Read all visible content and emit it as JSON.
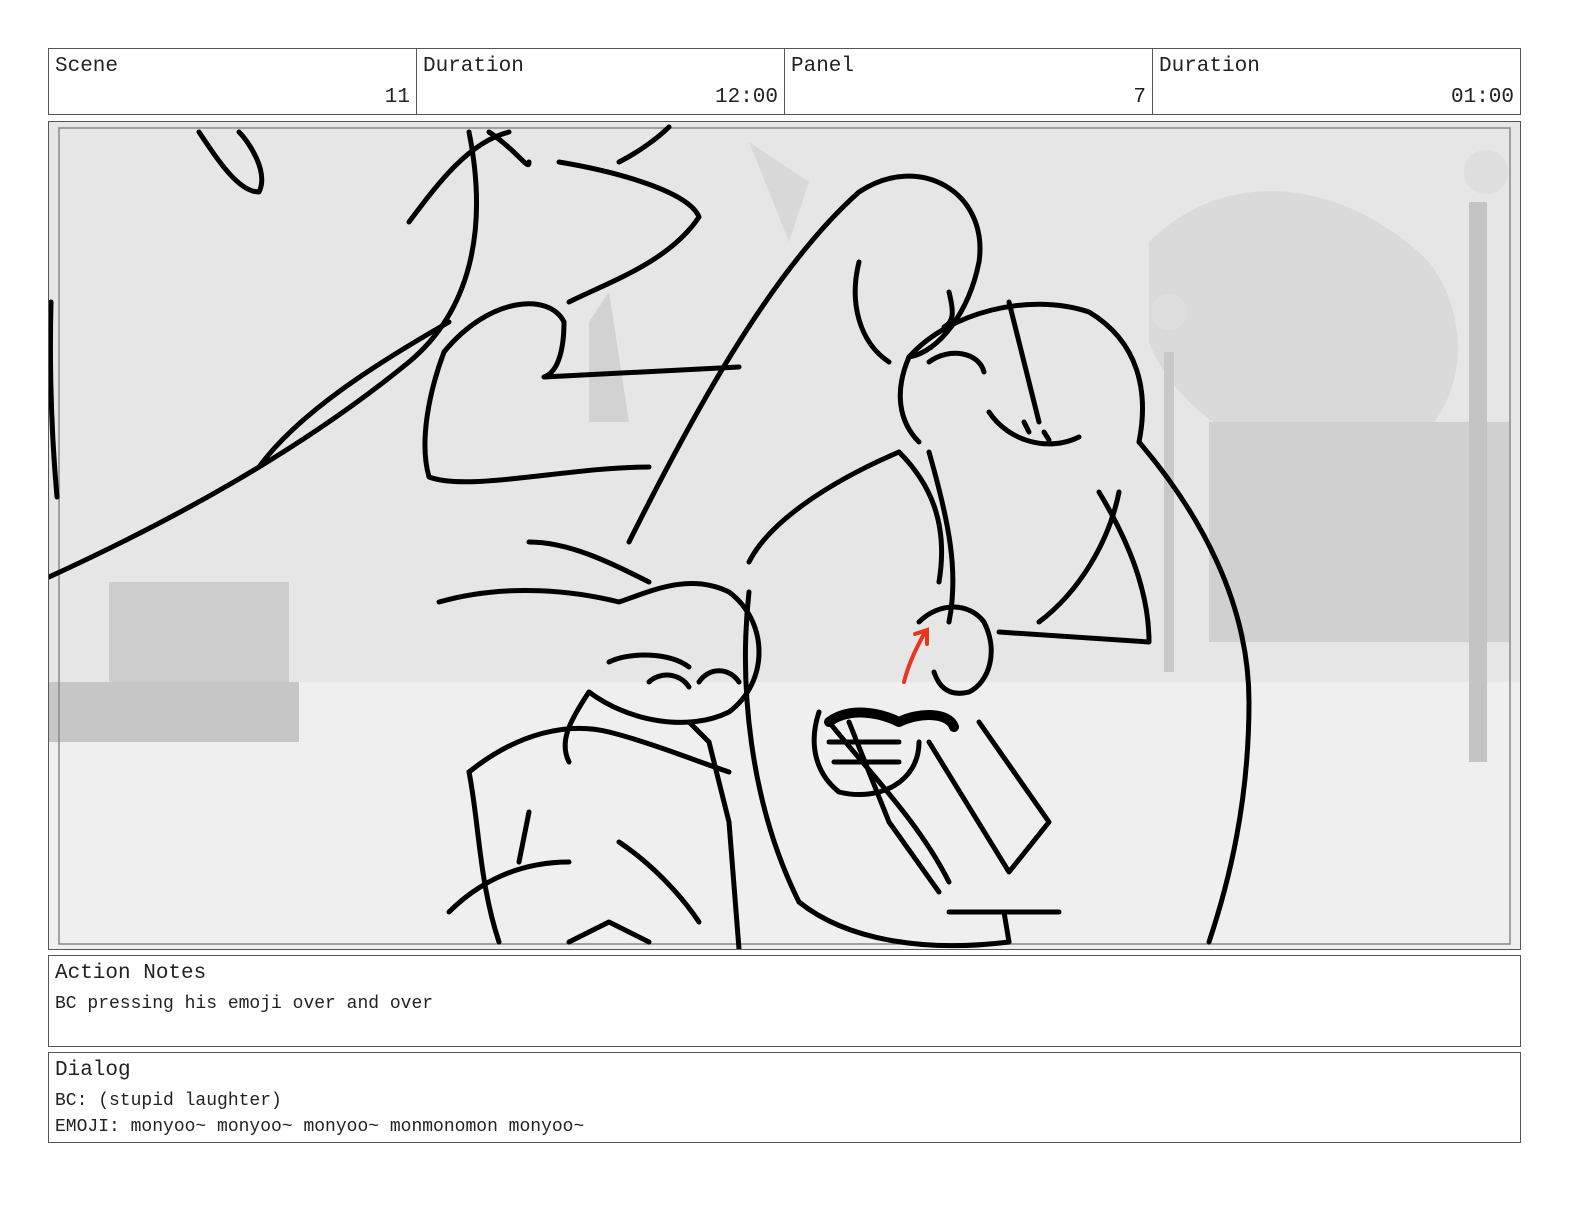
{
  "header": {
    "scene_label": "Scene",
    "scene_value": "11",
    "scene_duration_label": "Duration",
    "scene_duration_value": "12:00",
    "panel_label": "Panel",
    "panel_value": "7",
    "panel_duration_label": "Duration",
    "panel_duration_value": "01:00"
  },
  "action_notes": {
    "title": "Action Notes",
    "text": "BC pressing his emoji over and over"
  },
  "dialog": {
    "title": "Dialog",
    "lines": [
      "BC: (stupid laughter)",
      "EMOJI: monyoo~ monyoo~ monyoo~ monmonomon monyoo~"
    ]
  },
  "colors": {
    "border": "#555555",
    "sketch_line": "#000000",
    "accent_arrow": "#e8351f",
    "background_gray": "#e8e8e8"
  }
}
